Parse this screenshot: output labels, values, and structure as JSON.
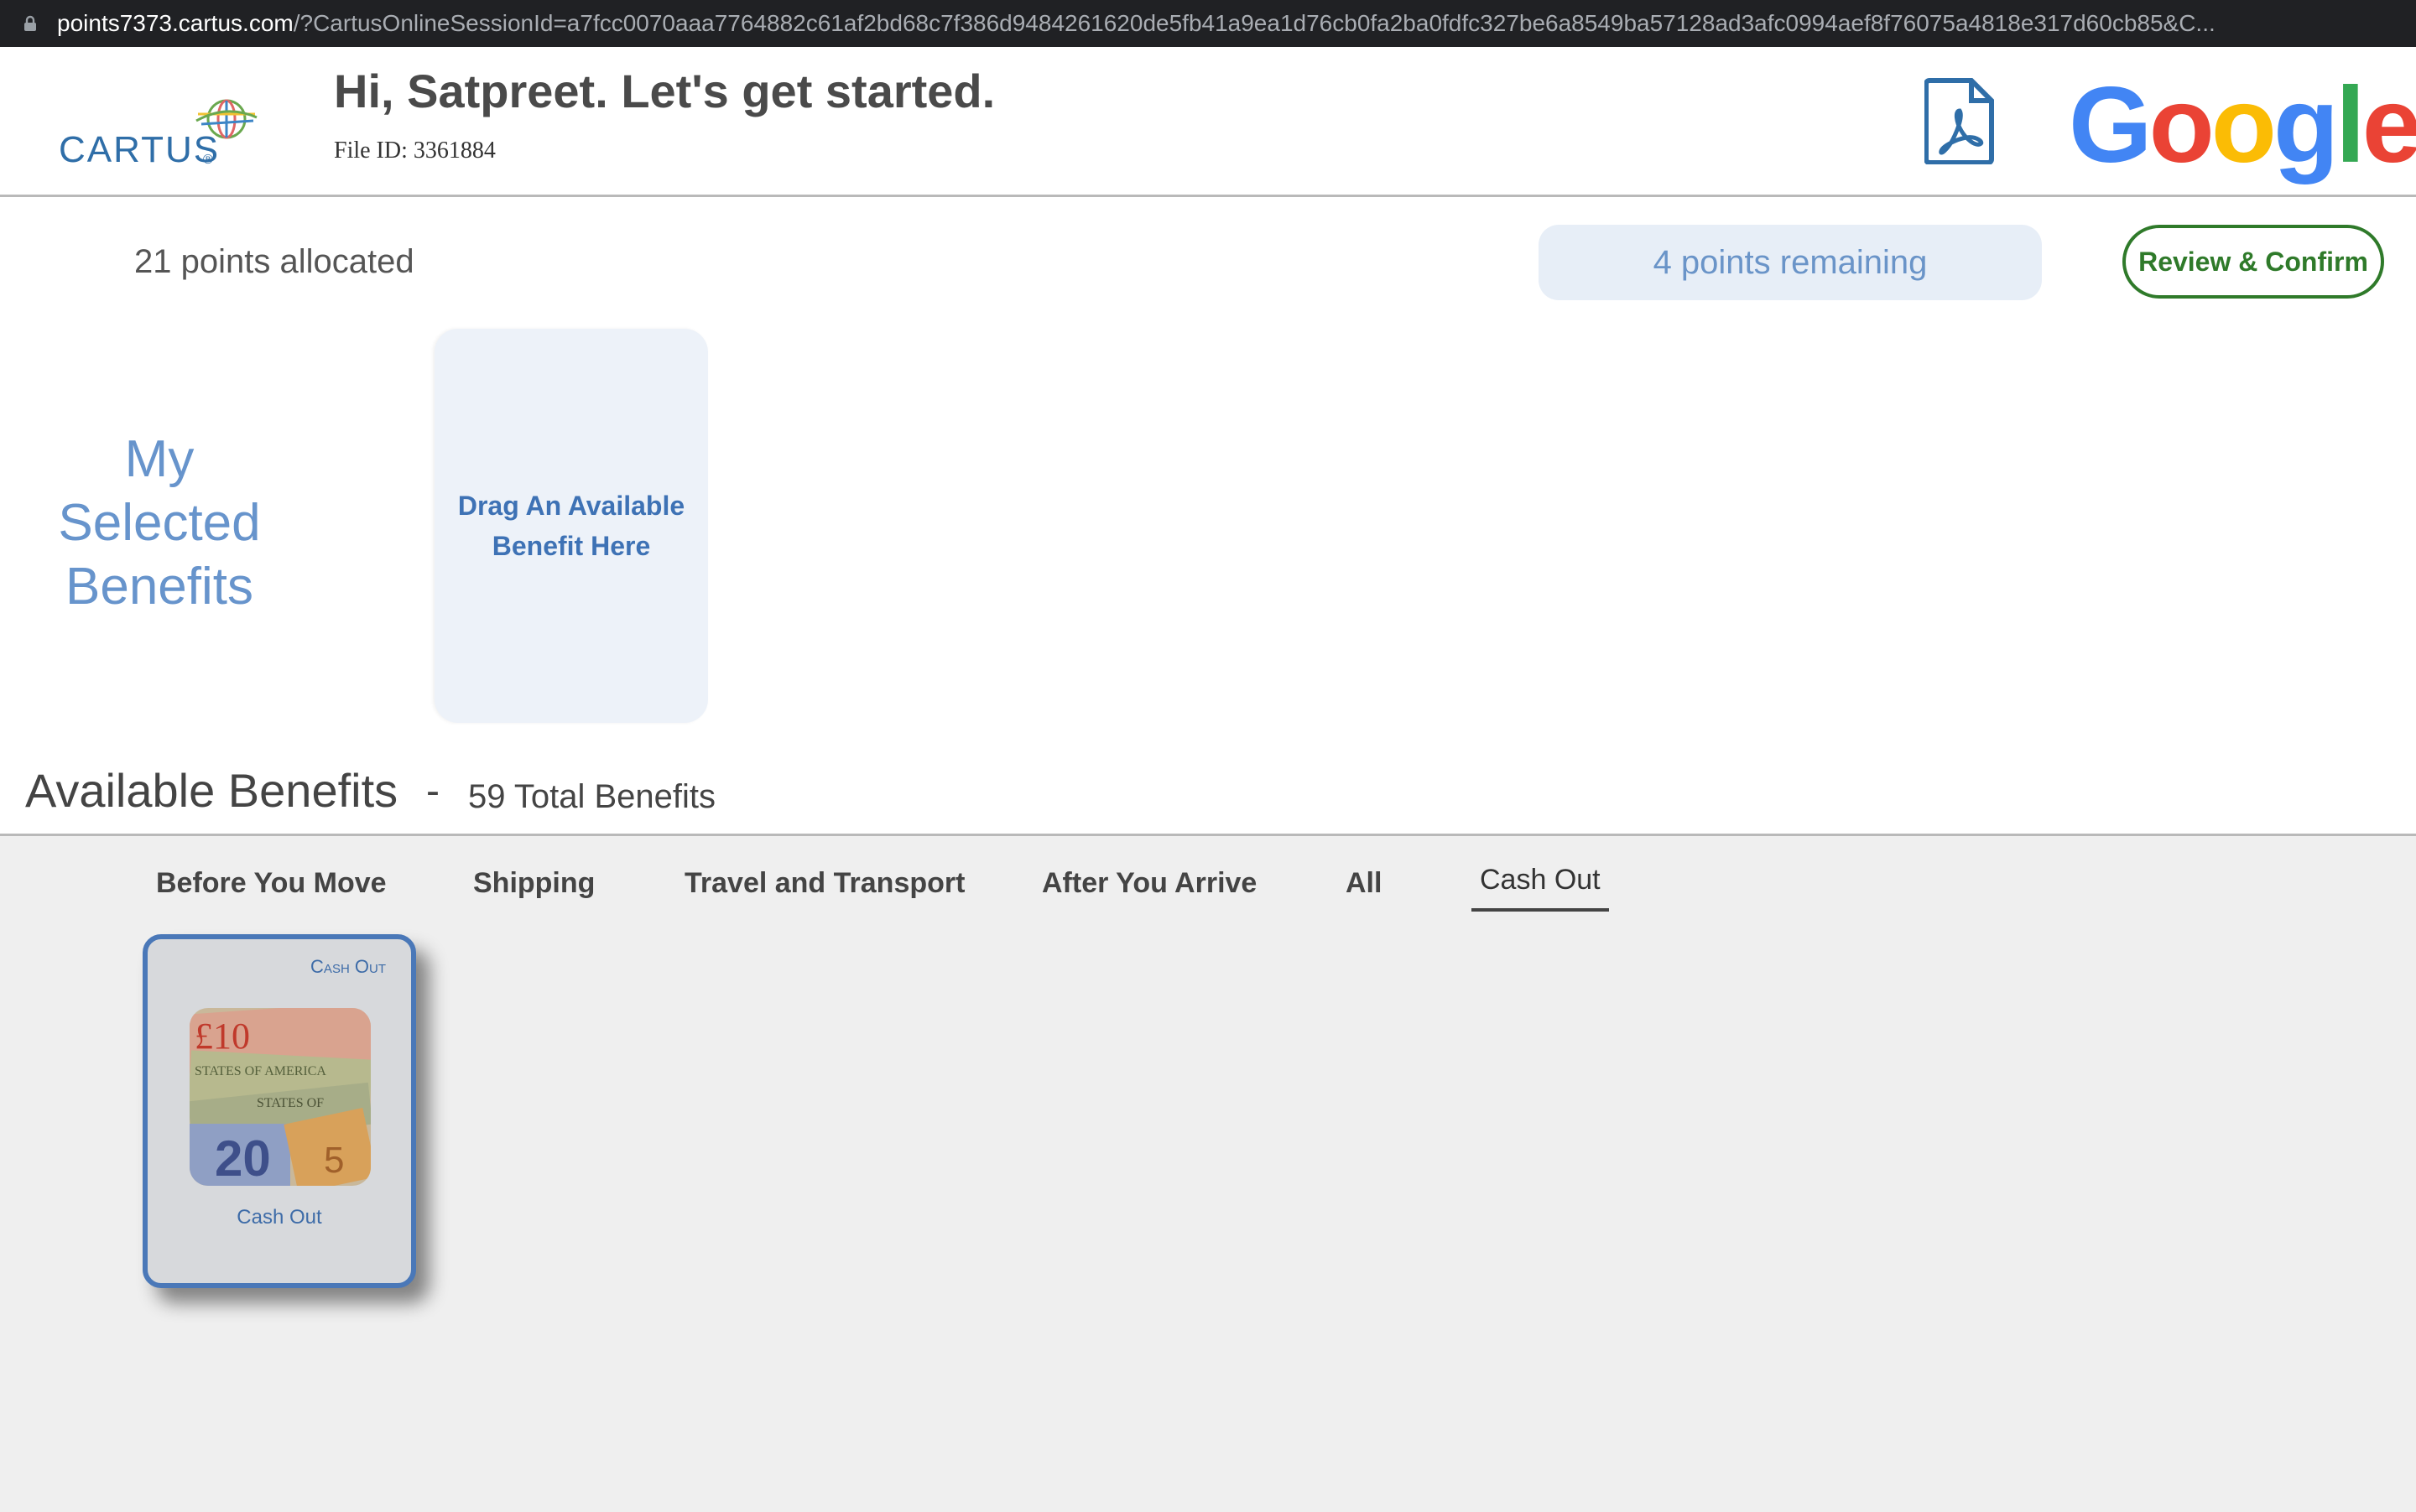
{
  "browser": {
    "url_host": "points7373.cartus.com",
    "url_rest": "/?CartusOnlineSessionId=a7fcc0070aaa7764882c61af2bd68c7f386d9484261620de5fb41a9ea1d76cb0fa2ba0fdfc327be6a8549ba57128ad3afc0994aef8f76075a4818e317d60cb85&C..."
  },
  "header": {
    "logo_text": "CARTUS",
    "logo_reg": "®",
    "greeting": "Hi, Satpreet. Let's get started.",
    "file_id_label": "File ID:",
    "file_id": "3361884",
    "pdf_icon": "pdf-document-icon",
    "partner_logo": [
      "G",
      "o",
      "o",
      "g",
      "l",
      "e"
    ],
    "partner_colors": [
      "#4285F4",
      "#EA4335",
      "#FBBC05",
      "#4285F4",
      "#34A853",
      "#EA4335"
    ]
  },
  "points": {
    "allocated": "21 points allocated",
    "remaining": "4 points remaining",
    "review_button": "Review & Confirm"
  },
  "selected": {
    "title_line1": "My",
    "title_line2": "Selected",
    "title_line3": "Benefits",
    "drop_line1": "Drag An Available",
    "drop_line2": "Benefit Here"
  },
  "available": {
    "title": "Available Benefits",
    "dash": "-",
    "count": "59 Total Benefits",
    "tabs": [
      "Before You Move",
      "Shipping",
      "Travel and Transport",
      "After You Arrive",
      "All",
      "Cash Out"
    ],
    "active_tab": "Cash Out",
    "cards": [
      {
        "category": "Cash Out",
        "name": "Cash Out",
        "image": "currency-banknotes-image"
      }
    ]
  },
  "colors": {
    "accent_blue": "#6794cc",
    "confirm_green": "#2f7a2a",
    "card_border": "#4a78b8"
  }
}
